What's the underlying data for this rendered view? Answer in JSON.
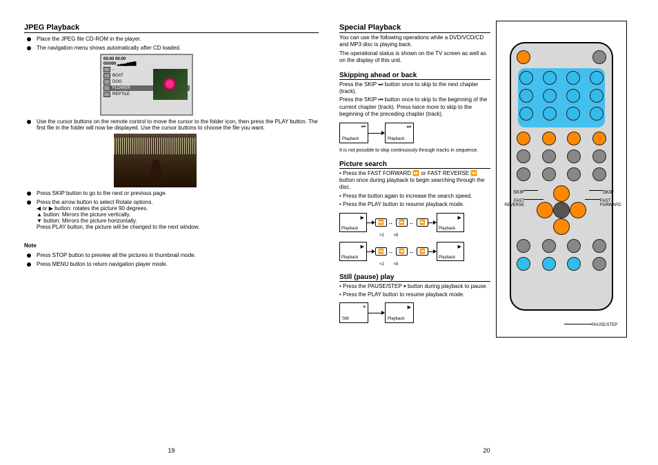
{
  "left": {
    "heading": "JPEG Playback",
    "bul1": "Place the JPEG file CD-ROM in the player.",
    "bul2": "The navigation menu shows automatically after CD loaded.",
    "menu_rows": [
      "..",
      "BOAT",
      "DOG",
      "FLOWER",
      "REPTILE"
    ],
    "bul3": "Use the cursor buttons on the remote control to move the cursor to the folder icon, then press the PLAY button. The first file in the folder will now be displayed. Use the cursor buttons to choose the file you want.",
    "bul4": "Press SKIP button to go to the next or previous page.",
    "bul5_a": "Press the arrow button to select Rotate options.",
    "bul5_b": "◀ or ▶ button: rotates the picture 90 degrees.",
    "bul5_c": "▲ button: Mirrors the picture vertically.",
    "bul5_d": "▼ button: Mirrors the picture horizontally.",
    "bul5_e": "Press PLAY button, the picture will be changed to the next window.",
    "note_h": "Note",
    "note1": "Press STOP button to preview all the pictures in thumbnail mode.",
    "note2": "Press MENU button to return navigation player mode.",
    "page": "19"
  },
  "right": {
    "heading": "Special Playback",
    "intro1": "You can use the following operations while a DVD/VCD/CD and MP3 disc is playing back.",
    "intro2": "The operational status is shown on the TV screen as well as on the display of this unit.",
    "sec1_h": "Skipping ahead or back",
    "sec1_a": "Press the SKIP ⏭ button once to skip to the next chapter (track).",
    "sec1_b": "Press the SKIP ⏮ button once to skip to the beginning of the current chapter (track). Press twice more to skip to the beginning of the preceding chapter (track).",
    "box1_label": "Playback",
    "box2_label": "Playback",
    "note_small": "It is not possible to skip continuously through tracks in sequence.",
    "sec2_h": "Picture search",
    "sec2_a": "• Press the FAST FORWARD ⏩ or FAST REVERSE ⏪ button once during playback to begin searching through the disc.",
    "sec2_b": "• Press the button again to increase the search speed.",
    "sec2_c": "• Press the PLAY button to resume playback mode.",
    "flow_play": "Playback",
    "flow_x2": "×2",
    "flow_x8": "×8",
    "sec3_h": "Still (pause) play",
    "sec3_a": "• Press the PAUSE/STEP ⏸ button during playback to pause.",
    "sec3_b": "• Press the PLAY button to resume playback mode.",
    "box_pause": "Still",
    "box_resume": "Playback",
    "remote_labels": {
      "skip": "SKIP",
      "ffwd": "FAST FORWARD",
      "frev": "FAST REVERSE",
      "pause": "PAUSE/STEP"
    },
    "page": "20"
  }
}
